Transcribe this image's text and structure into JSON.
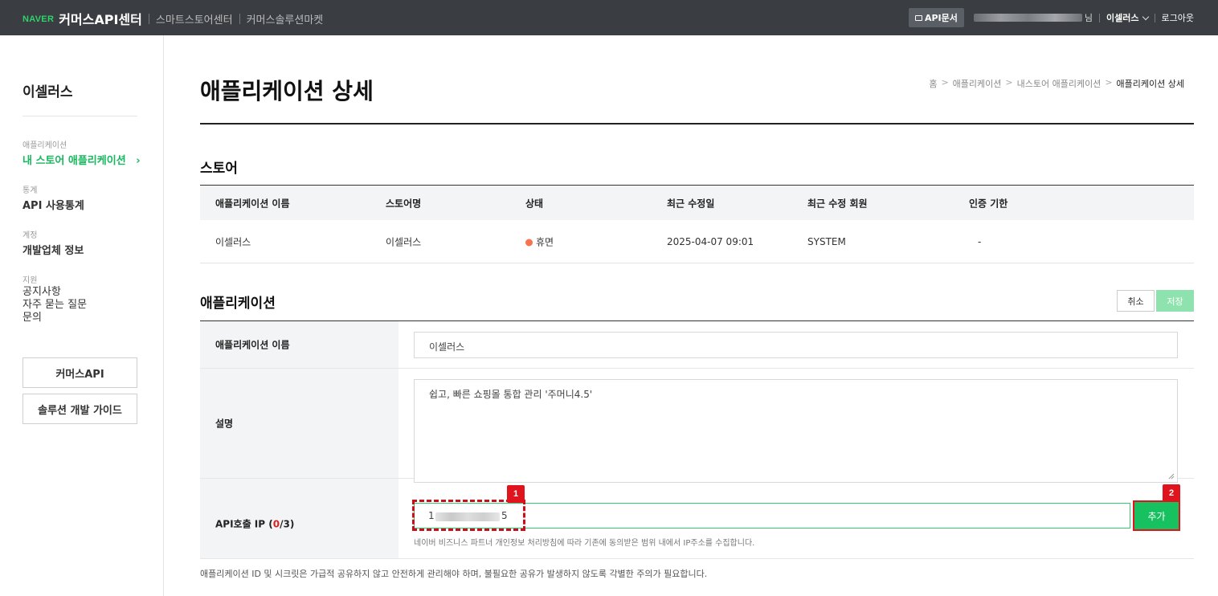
{
  "topbar": {
    "naver": "NAVER",
    "brand": "커머스API센터",
    "links": [
      "스마트스토어센터",
      "커머스솔루션마켓"
    ],
    "apidoc": "API문서",
    "user_suffix": "님",
    "store": "이셀러스",
    "logout": "로그아웃"
  },
  "sidebar": {
    "store_name": "이셀러스",
    "groups": [
      {
        "category": "애플리케이션",
        "items": [
          "내 스토어 애플리케이션"
        ]
      },
      {
        "category": "통계",
        "items": [
          "API 사용통계"
        ]
      },
      {
        "category": "계정",
        "items": [
          "개발업체 정보"
        ]
      },
      {
        "category": "지원",
        "items": [
          "공지사항",
          "자주 묻는 질문",
          "문의"
        ]
      }
    ],
    "buttons": [
      "커머스API",
      "솔루션 개발 가이드"
    ]
  },
  "page": {
    "title": "애플리케이션 상세",
    "breadcrumb": [
      "홈",
      "애플리케이션",
      "내스토어 애플리케이션",
      "애플리케이션 상세"
    ]
  },
  "store_section": {
    "title": "스토어",
    "columns": [
      "애플리케이션 이름",
      "스토어명",
      "상태",
      "최근 수정일",
      "최근 수정 회원",
      "인증 기한"
    ],
    "row": [
      "이셀러스",
      "이셀러스",
      "휴면",
      "2025-04-07 09:01",
      "SYSTEM",
      "-"
    ],
    "status_color": "#f5744d"
  },
  "app_section": {
    "title": "애플리케이션",
    "cancel": "취소",
    "save": "저장",
    "name_label": "애플리케이션 이름",
    "name_value": "이셀러스",
    "desc_label": "설명",
    "desc_value": "쉽고, 빠른 쇼핑몰 통합 관리 '주머니4.5'",
    "ip_label_prefix": "API호출 IP (",
    "ip_count": "0",
    "ip_label_suffix": "/3)",
    "ip_value": "1",
    "ip_value_end": "5",
    "add": "추가",
    "ip_help": "네이버 비즈니스 파트너 개인정보 처리방침에 따라 기존에 동의받은 범위 내에서 IP주소를 수집합니다.",
    "badge1": "1",
    "badge2": "2"
  },
  "bottom_note": "애플리케이션 ID 및 시크릿은 가급적 공유하지 않고 안전하게 관리해야 하며, 불필요한 공유가 발생하지 않도록 각별한 주의가 필요합니다."
}
